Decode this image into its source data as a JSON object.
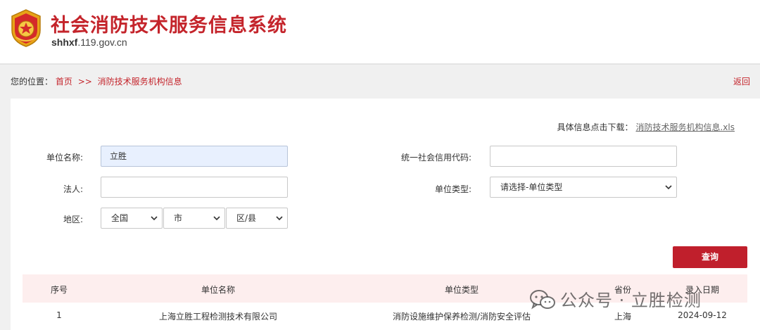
{
  "header": {
    "title": "社会消防技术服务信息系统",
    "domain_bold": "shhxf",
    "domain_rest": ".119.gov.cn"
  },
  "breadcrumb": {
    "prefix": "您的位置：",
    "home": "首页",
    "separator": ">>",
    "current": "消防技术服务机构信息",
    "back": "返回"
  },
  "download": {
    "label": "具体信息点击下载：",
    "file": "消防技术服务机构信息.xls"
  },
  "form": {
    "unit_name_label": "单位名称:",
    "unit_name_value": "立胜",
    "credit_code_label": "统一社会信用代码:",
    "credit_code_value": "",
    "legal_person_label": "法人:",
    "legal_person_value": "",
    "unit_type_label": "单位类型:",
    "unit_type_selected": "请选择-单位类型",
    "region_label": "地区:",
    "province_selected": "全国",
    "city_selected": "市",
    "district_selected": "区/县",
    "query_button": "查询"
  },
  "table": {
    "columns": [
      "序号",
      "单位名称",
      "单位类型",
      "省份",
      "录入日期"
    ],
    "rows": [
      [
        "1",
        "上海立胜工程检测技术有限公司",
        "消防设施维护保养检测/消防安全评估",
        "上海",
        "2024-09-12"
      ]
    ]
  },
  "watermark": {
    "text": "公众号 · 立胜检测",
    "icon": "wechat-icon"
  },
  "colors": {
    "brand_red": "#c4242b",
    "button_red": "#c01f2c",
    "table_header_bg": "#fdeeee",
    "filled_input_bg": "#e8f0fe"
  }
}
